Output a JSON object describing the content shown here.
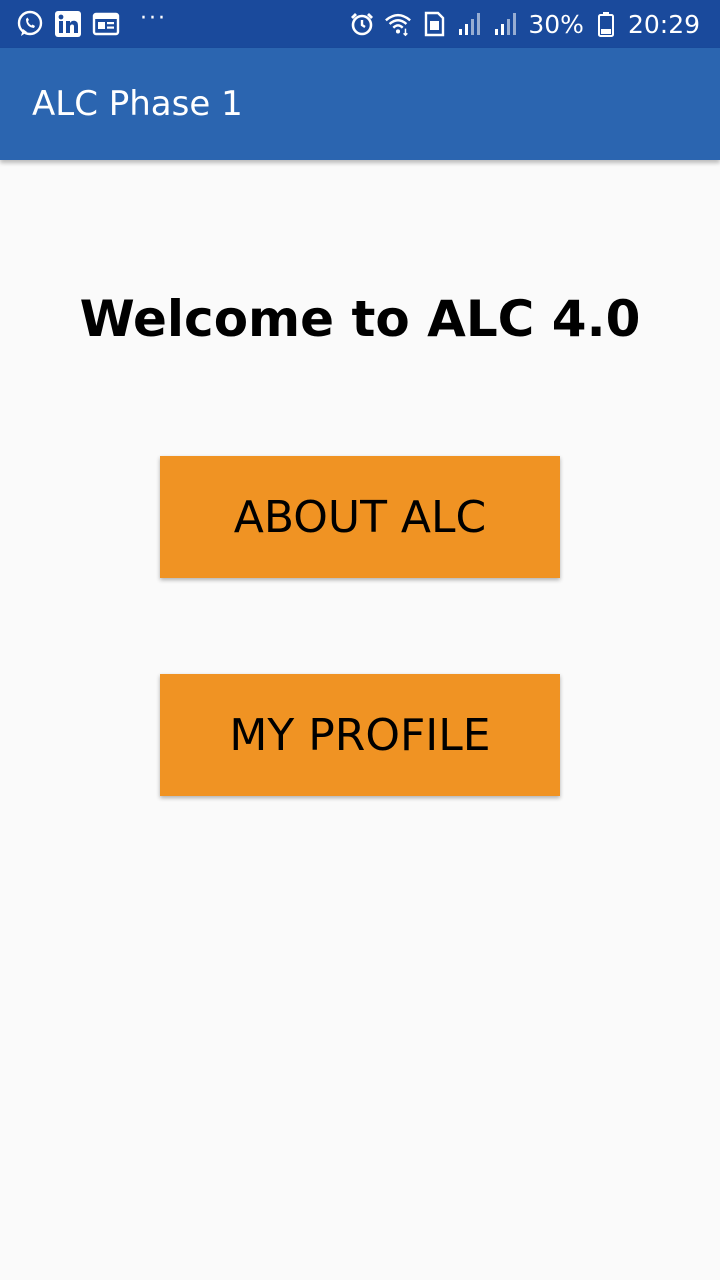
{
  "status_bar": {
    "left_icons": [
      "whatsapp-icon",
      "linkedin-icon",
      "news-icon"
    ],
    "more_label": "···",
    "right_icons": [
      "alarm-icon",
      "wifi-icon",
      "sim-icon",
      "signal-icon",
      "signal-icon",
      "battery-icon"
    ],
    "battery": "30%",
    "time": "20:29"
  },
  "app_bar": {
    "title": "ALC Phase 1"
  },
  "main": {
    "welcome": "Welcome to ALC 4.0",
    "buttons": [
      {
        "label": "ABOUT ALC"
      },
      {
        "label": "MY PROFILE"
      }
    ]
  },
  "colors": {
    "status_bar": "#1a4a9c",
    "app_bar": "#2b65b0",
    "button": "#f09323",
    "background": "#fafafa"
  }
}
